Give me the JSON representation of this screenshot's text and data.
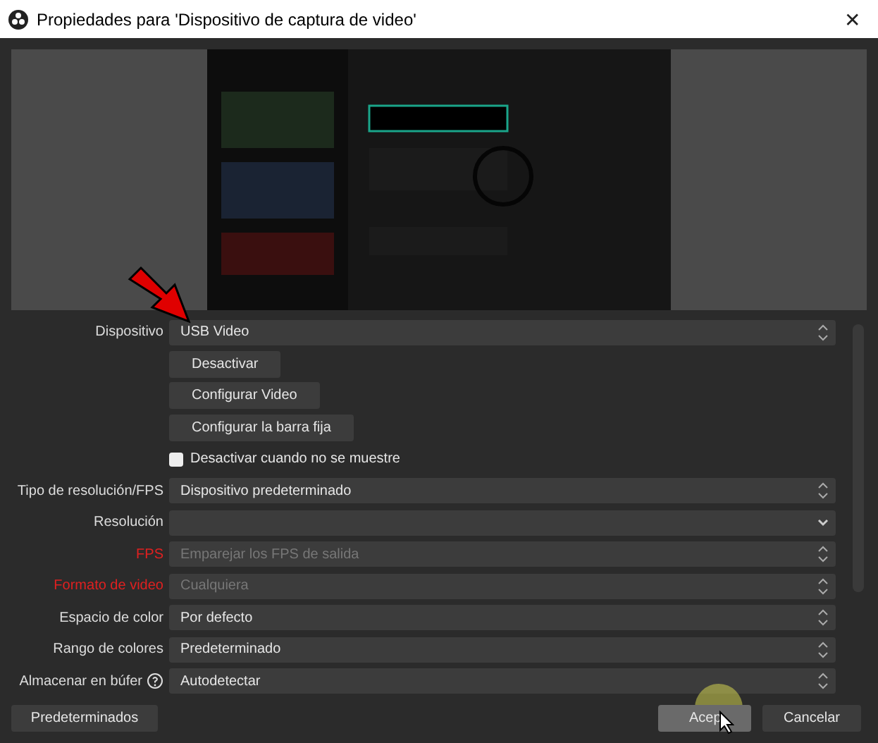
{
  "window": {
    "title": "Propiedades para 'Dispositivo de captura de video'",
    "close": "✕"
  },
  "rows": [
    {
      "kind": "select",
      "label": "Dispositivo",
      "value": "USB Video",
      "spinner": true,
      "disabled": false,
      "help": false
    },
    {
      "kind": "button",
      "text": "Desactivar"
    },
    {
      "kind": "button",
      "text": "Configurar Video"
    },
    {
      "kind": "button",
      "text": "Configurar la barra fija"
    },
    {
      "kind": "checkbox",
      "text": "Desactivar cuando no se muestre",
      "checked": false
    },
    {
      "kind": "select",
      "label": "Tipo de resolución/FPS",
      "value": "Dispositivo predeterminado",
      "spinner": true,
      "disabled": false,
      "help": false
    },
    {
      "kind": "select",
      "label": "Resolución",
      "value": "",
      "spinner": false,
      "disabled": false,
      "help": false
    },
    {
      "kind": "select",
      "label": "FPS",
      "value": "Emparejar los FPS de salida",
      "spinner": true,
      "disabled": true,
      "help": false
    },
    {
      "kind": "select",
      "label": "Formato de video",
      "value": "Cualquiera",
      "spinner": true,
      "disabled": true,
      "help": false
    },
    {
      "kind": "select",
      "label": "Espacio de color",
      "value": "Por defecto",
      "spinner": true,
      "disabled": false,
      "help": false
    },
    {
      "kind": "select",
      "label": "Rango de colores",
      "value": "Predeterminado",
      "spinner": true,
      "disabled": false,
      "help": false
    },
    {
      "kind": "select",
      "label": "Almacenar en búfer",
      "value": "Autodetectar",
      "spinner": true,
      "disabled": false,
      "help": true
    }
  ],
  "footer": {
    "defaults": "Predeterminados",
    "ok": "Acep",
    "cancel": "Cancelar"
  }
}
